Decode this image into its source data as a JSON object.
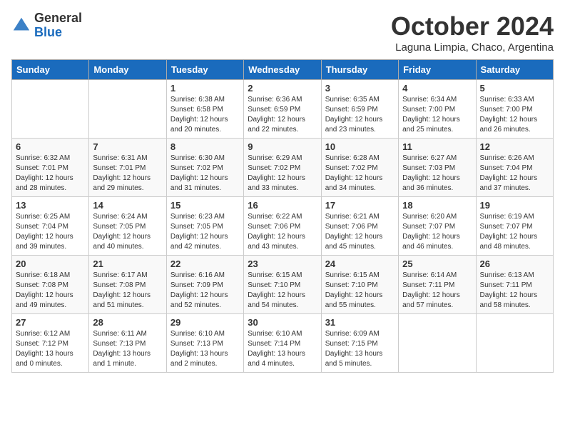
{
  "logo": {
    "general": "General",
    "blue": "Blue"
  },
  "title": "October 2024",
  "location": "Laguna Limpia, Chaco, Argentina",
  "days_header": [
    "Sunday",
    "Monday",
    "Tuesday",
    "Wednesday",
    "Thursday",
    "Friday",
    "Saturday"
  ],
  "weeks": [
    [
      {
        "day": "",
        "info": ""
      },
      {
        "day": "",
        "info": ""
      },
      {
        "day": "1",
        "info": "Sunrise: 6:38 AM\nSunset: 6:58 PM\nDaylight: 12 hours\nand 20 minutes."
      },
      {
        "day": "2",
        "info": "Sunrise: 6:36 AM\nSunset: 6:59 PM\nDaylight: 12 hours\nand 22 minutes."
      },
      {
        "day": "3",
        "info": "Sunrise: 6:35 AM\nSunset: 6:59 PM\nDaylight: 12 hours\nand 23 minutes."
      },
      {
        "day": "4",
        "info": "Sunrise: 6:34 AM\nSunset: 7:00 PM\nDaylight: 12 hours\nand 25 minutes."
      },
      {
        "day": "5",
        "info": "Sunrise: 6:33 AM\nSunset: 7:00 PM\nDaylight: 12 hours\nand 26 minutes."
      }
    ],
    [
      {
        "day": "6",
        "info": "Sunrise: 6:32 AM\nSunset: 7:01 PM\nDaylight: 12 hours\nand 28 minutes."
      },
      {
        "day": "7",
        "info": "Sunrise: 6:31 AM\nSunset: 7:01 PM\nDaylight: 12 hours\nand 29 minutes."
      },
      {
        "day": "8",
        "info": "Sunrise: 6:30 AM\nSunset: 7:02 PM\nDaylight: 12 hours\nand 31 minutes."
      },
      {
        "day": "9",
        "info": "Sunrise: 6:29 AM\nSunset: 7:02 PM\nDaylight: 12 hours\nand 33 minutes."
      },
      {
        "day": "10",
        "info": "Sunrise: 6:28 AM\nSunset: 7:02 PM\nDaylight: 12 hours\nand 34 minutes."
      },
      {
        "day": "11",
        "info": "Sunrise: 6:27 AM\nSunset: 7:03 PM\nDaylight: 12 hours\nand 36 minutes."
      },
      {
        "day": "12",
        "info": "Sunrise: 6:26 AM\nSunset: 7:04 PM\nDaylight: 12 hours\nand 37 minutes."
      }
    ],
    [
      {
        "day": "13",
        "info": "Sunrise: 6:25 AM\nSunset: 7:04 PM\nDaylight: 12 hours\nand 39 minutes."
      },
      {
        "day": "14",
        "info": "Sunrise: 6:24 AM\nSunset: 7:05 PM\nDaylight: 12 hours\nand 40 minutes."
      },
      {
        "day": "15",
        "info": "Sunrise: 6:23 AM\nSunset: 7:05 PM\nDaylight: 12 hours\nand 42 minutes."
      },
      {
        "day": "16",
        "info": "Sunrise: 6:22 AM\nSunset: 7:06 PM\nDaylight: 12 hours\nand 43 minutes."
      },
      {
        "day": "17",
        "info": "Sunrise: 6:21 AM\nSunset: 7:06 PM\nDaylight: 12 hours\nand 45 minutes."
      },
      {
        "day": "18",
        "info": "Sunrise: 6:20 AM\nSunset: 7:07 PM\nDaylight: 12 hours\nand 46 minutes."
      },
      {
        "day": "19",
        "info": "Sunrise: 6:19 AM\nSunset: 7:07 PM\nDaylight: 12 hours\nand 48 minutes."
      }
    ],
    [
      {
        "day": "20",
        "info": "Sunrise: 6:18 AM\nSunset: 7:08 PM\nDaylight: 12 hours\nand 49 minutes."
      },
      {
        "day": "21",
        "info": "Sunrise: 6:17 AM\nSunset: 7:08 PM\nDaylight: 12 hours\nand 51 minutes."
      },
      {
        "day": "22",
        "info": "Sunrise: 6:16 AM\nSunset: 7:09 PM\nDaylight: 12 hours\nand 52 minutes."
      },
      {
        "day": "23",
        "info": "Sunrise: 6:15 AM\nSunset: 7:10 PM\nDaylight: 12 hours\nand 54 minutes."
      },
      {
        "day": "24",
        "info": "Sunrise: 6:15 AM\nSunset: 7:10 PM\nDaylight: 12 hours\nand 55 minutes."
      },
      {
        "day": "25",
        "info": "Sunrise: 6:14 AM\nSunset: 7:11 PM\nDaylight: 12 hours\nand 57 minutes."
      },
      {
        "day": "26",
        "info": "Sunrise: 6:13 AM\nSunset: 7:11 PM\nDaylight: 12 hours\nand 58 minutes."
      }
    ],
    [
      {
        "day": "27",
        "info": "Sunrise: 6:12 AM\nSunset: 7:12 PM\nDaylight: 13 hours\nand 0 minutes."
      },
      {
        "day": "28",
        "info": "Sunrise: 6:11 AM\nSunset: 7:13 PM\nDaylight: 13 hours\nand 1 minute."
      },
      {
        "day": "29",
        "info": "Sunrise: 6:10 AM\nSunset: 7:13 PM\nDaylight: 13 hours\nand 2 minutes."
      },
      {
        "day": "30",
        "info": "Sunrise: 6:10 AM\nSunset: 7:14 PM\nDaylight: 13 hours\nand 4 minutes."
      },
      {
        "day": "31",
        "info": "Sunrise: 6:09 AM\nSunset: 7:15 PM\nDaylight: 13 hours\nand 5 minutes."
      },
      {
        "day": "",
        "info": ""
      },
      {
        "day": "",
        "info": ""
      }
    ]
  ]
}
